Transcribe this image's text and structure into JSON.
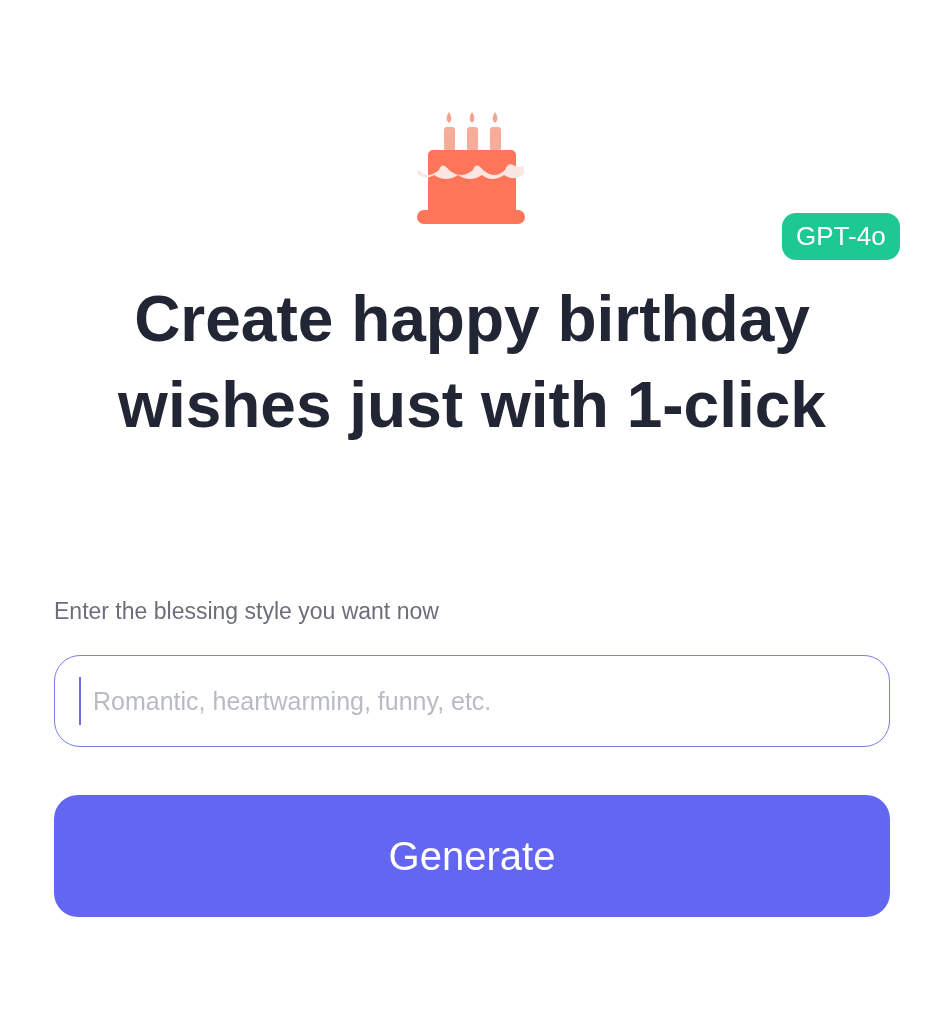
{
  "badge": "GPT-4o",
  "title": "Create happy birthday wishes just with 1-click",
  "field": {
    "label": "Enter the blessing style you want now",
    "placeholder": "Romantic, heartwarming, funny, etc.",
    "focused": true
  },
  "button": "Generate"
}
